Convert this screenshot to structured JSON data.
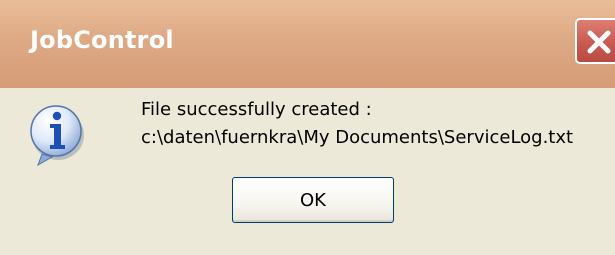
{
  "window": {
    "title": "JobControl"
  },
  "message": {
    "line1": "File successfully created :",
    "line2": "c:\\daten\\fuernkra\\My Documents\\ServiceLog.txt"
  },
  "buttons": {
    "ok_label": "OK"
  },
  "icons": {
    "info": "information-icon",
    "close": "close-icon"
  },
  "colors": {
    "titlebar": "#dea985",
    "body": "#ece9d8",
    "close_button": "#c75b51"
  }
}
